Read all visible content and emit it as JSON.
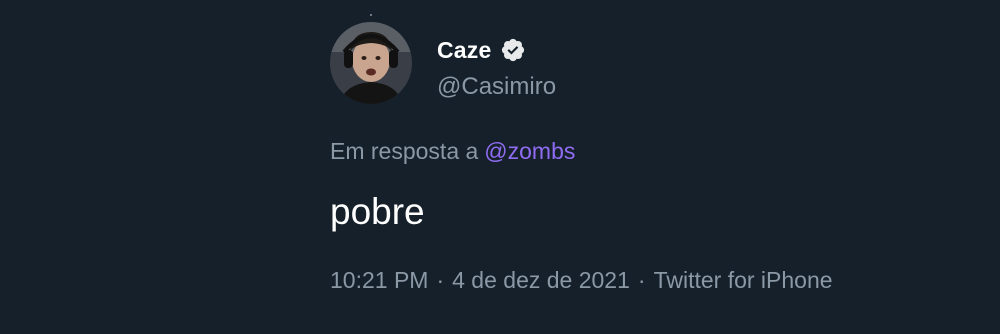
{
  "author": {
    "display_name": "Caze",
    "handle": "@Casimiro",
    "verified_icon": "verified-badge-icon",
    "avatar_icon": "avatar-photo"
  },
  "reply": {
    "prefix": "Em resposta a",
    "mention": "@zombs"
  },
  "tweet": {
    "text": "pobre"
  },
  "meta": {
    "time": "10:21 PM",
    "separator": "·",
    "date": "4 de dez de 2021",
    "source": "Twitter for iPhone"
  },
  "colors": {
    "background": "#15202b",
    "primary_text": "#ffffff",
    "secondary_text": "#8b98a5",
    "mention": "#8f6cf2"
  }
}
